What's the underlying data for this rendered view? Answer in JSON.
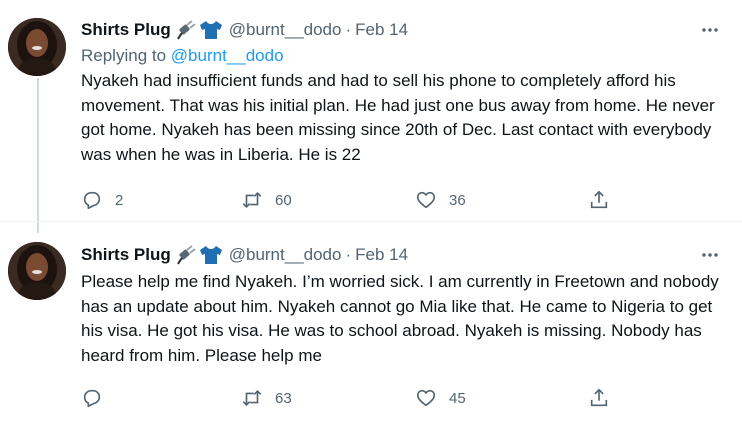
{
  "tweets": [
    {
      "display_name": "Shirts Plug",
      "name_emojis": [
        "plug-emoji",
        "tshirt-emoji"
      ],
      "handle": "@burnt__dodo",
      "separator": "·",
      "date": "Feb 14",
      "replying_prefix": "Replying to",
      "replying_to": "@burnt__dodo",
      "text": "Nyakeh had insufficient funds and had to sell his phone to completely afford his movement. That was his initial plan. He had just one bus away from home. He never got home. Nyakeh has been missing since 20th of Dec. Last contact with everybody was when he was in Liberia. He is 22",
      "replies": "2",
      "retweets": "60",
      "likes": "36"
    },
    {
      "display_name": "Shirts Plug",
      "name_emojis": [
        "plug-emoji",
        "tshirt-emoji"
      ],
      "handle": "@burnt__dodo",
      "separator": "·",
      "date": "Feb 14",
      "text": "Please help me find Nyakeh. I’m worried sick. I am currently in Freetown and nobody has an update about him. Nyakeh cannot go Mia like that. He came to Nigeria to get his visa. He got his visa. He was to school abroad. Nyakeh is missing. Nobody has heard from him. Please help me",
      "replies": "",
      "retweets": "63",
      "likes": "45"
    }
  ],
  "colors": {
    "text": "#0f1419",
    "muted": "#536471",
    "link": "#1d9bf0",
    "thread_line": "#cfd9de",
    "shirt_emoji": "#1f6fb2"
  }
}
